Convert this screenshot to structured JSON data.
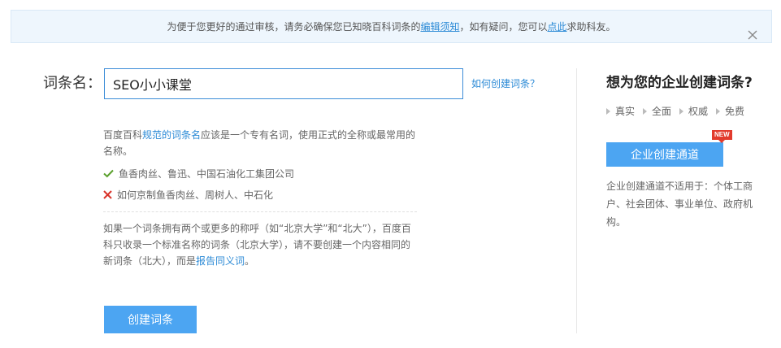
{
  "notice": {
    "text_before": "为便于您更好的通过审核，请务必确保您已知晓百科词条的",
    "link_guide": "编辑须知",
    "text_middle": "，如有疑问，您可以",
    "link_help": "点此",
    "text_after": "求助科友。"
  },
  "form": {
    "title_label": "词条名：",
    "title_value": "SEO小小课堂",
    "how_to_link": "如何创建词条？",
    "submit_label": "创建词条"
  },
  "tips": {
    "intro_prefix": "百度百科",
    "intro_link": "规范的词条名",
    "intro_suffix": "应该是一个专有名词，使用正式的全称或最常用的名称。",
    "good_example": "鱼香肉丝、鲁迅、中国石油化工集团公司",
    "bad_example": "如何京制鱼香肉丝、周树人、中石化",
    "synonym_text": "如果一个词条拥有两个或更多的称呼（如“北京大学”和“北大”），百度百科只收录一个标准名称的词条（北京大学），请不要创建一个内容相同的新词条（北大），而是",
    "synonym_link": "报告同义词",
    "synonym_end": "。"
  },
  "enterprise": {
    "title": "想为您的企业创建词条?",
    "features": [
      "真实",
      "全面",
      "权威",
      "免费"
    ],
    "button_label": "企业创建通道",
    "badge": "NEW",
    "description": "企业创建通道不适用于：个体工商户、社会团体、事业单位、政府机构。"
  },
  "colors": {
    "accent": "#4ca5f2",
    "link": "#2b8ad6",
    "notice_bg": "#eef6fd",
    "badge": "#e23b2d",
    "check": "#5aa02c",
    "cross": "#d9342b"
  },
  "icons": {
    "close": "close-icon",
    "good": "check-icon",
    "bad": "cross-icon",
    "feature": "triangle-bullet-icon"
  }
}
